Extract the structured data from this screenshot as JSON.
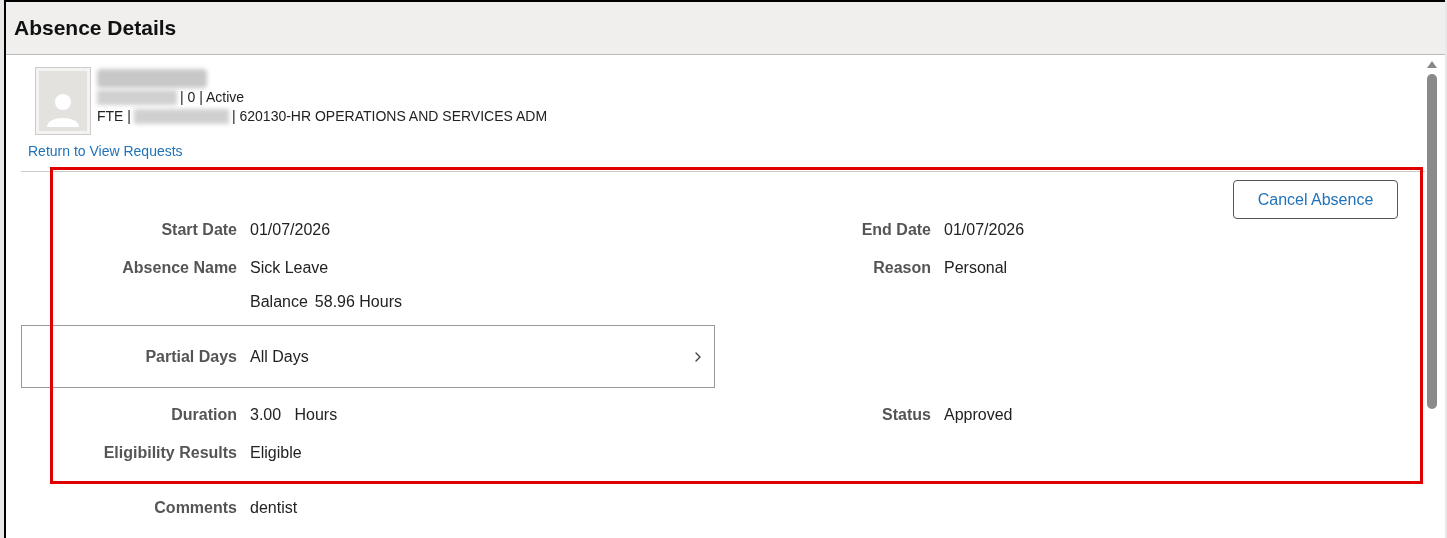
{
  "header": {
    "title": "Absence Details"
  },
  "employee": {
    "status_line": "| 0 | Active",
    "fte": "FTE |",
    "department": "| 620130-HR OPERATIONS AND SERVICES ADM"
  },
  "return_link": "Return to View Requests",
  "cancel_button": "Cancel Absence",
  "rows": [
    {
      "kind": "pair",
      "left": {
        "label": "Start Date",
        "value": "01/07/2026"
      },
      "right": {
        "label": "End Date",
        "value": "01/07/2026"
      }
    },
    {
      "kind": "pair",
      "left": {
        "label": "Absence Name",
        "value": "Sick Leave"
      },
      "right": {
        "label": "Reason",
        "value": "Personal"
      }
    },
    {
      "kind": "note",
      "label": "Balance",
      "value": "58.96 Hours"
    },
    {
      "kind": "link-box",
      "label": "Partial Days",
      "value": "All Days"
    },
    {
      "kind": "pair",
      "left": {
        "label": "Duration",
        "value": "3.00   Hours"
      },
      "right": {
        "label": "Status",
        "value": "Approved"
      }
    },
    {
      "kind": "pair",
      "left": {
        "label": "Eligibility Results",
        "value": "Eligible"
      }
    },
    {
      "kind": "spacer"
    },
    {
      "kind": "pair",
      "left": {
        "label": "Comments",
        "value": "dentist"
      }
    }
  ]
}
